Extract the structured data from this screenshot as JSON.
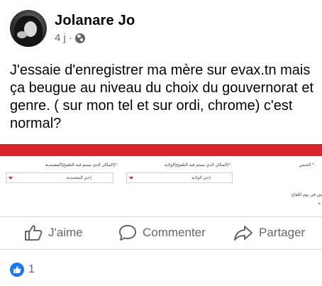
{
  "post": {
    "author": "Jolanare Jo",
    "time": "4 j",
    "separator": "·",
    "privacy_icon": "globe-icon",
    "text": "J'essaie d'enregistrer ma mère  sur evax.tn mais ça beugue au niveau du choix du gouvernorat et genre. ( sur mon tel et sur ordi, chrome) c'est normal?"
  },
  "attached_screenshot": {
    "accent_color": "#d8232a",
    "fields": [
      {
        "label": ":*(المكان الذي سيتم فيه التلقيح(المعتمدية",
        "value": "إختر المعتمدية"
      },
      {
        "label": ":*(المكان الذي سيتم فيه التلقيح(الولاية",
        "value": "إختر الولاية"
      },
      {
        "label": ":* الجنس"
      }
    ],
    "cutoff_text": [
      "ش في يوم اللقاح:",
      "ة"
    ]
  },
  "actions": {
    "like": {
      "label": "J'aime",
      "icon": "thumbs-up-icon"
    },
    "comment": {
      "label": "Commenter",
      "icon": "comment-bubble-icon"
    },
    "share": {
      "label": "Partager",
      "icon": "share-arrow-icon"
    }
  },
  "reactions": {
    "icon": "like-reaction-icon",
    "color": "#1877f2",
    "count": "1"
  }
}
